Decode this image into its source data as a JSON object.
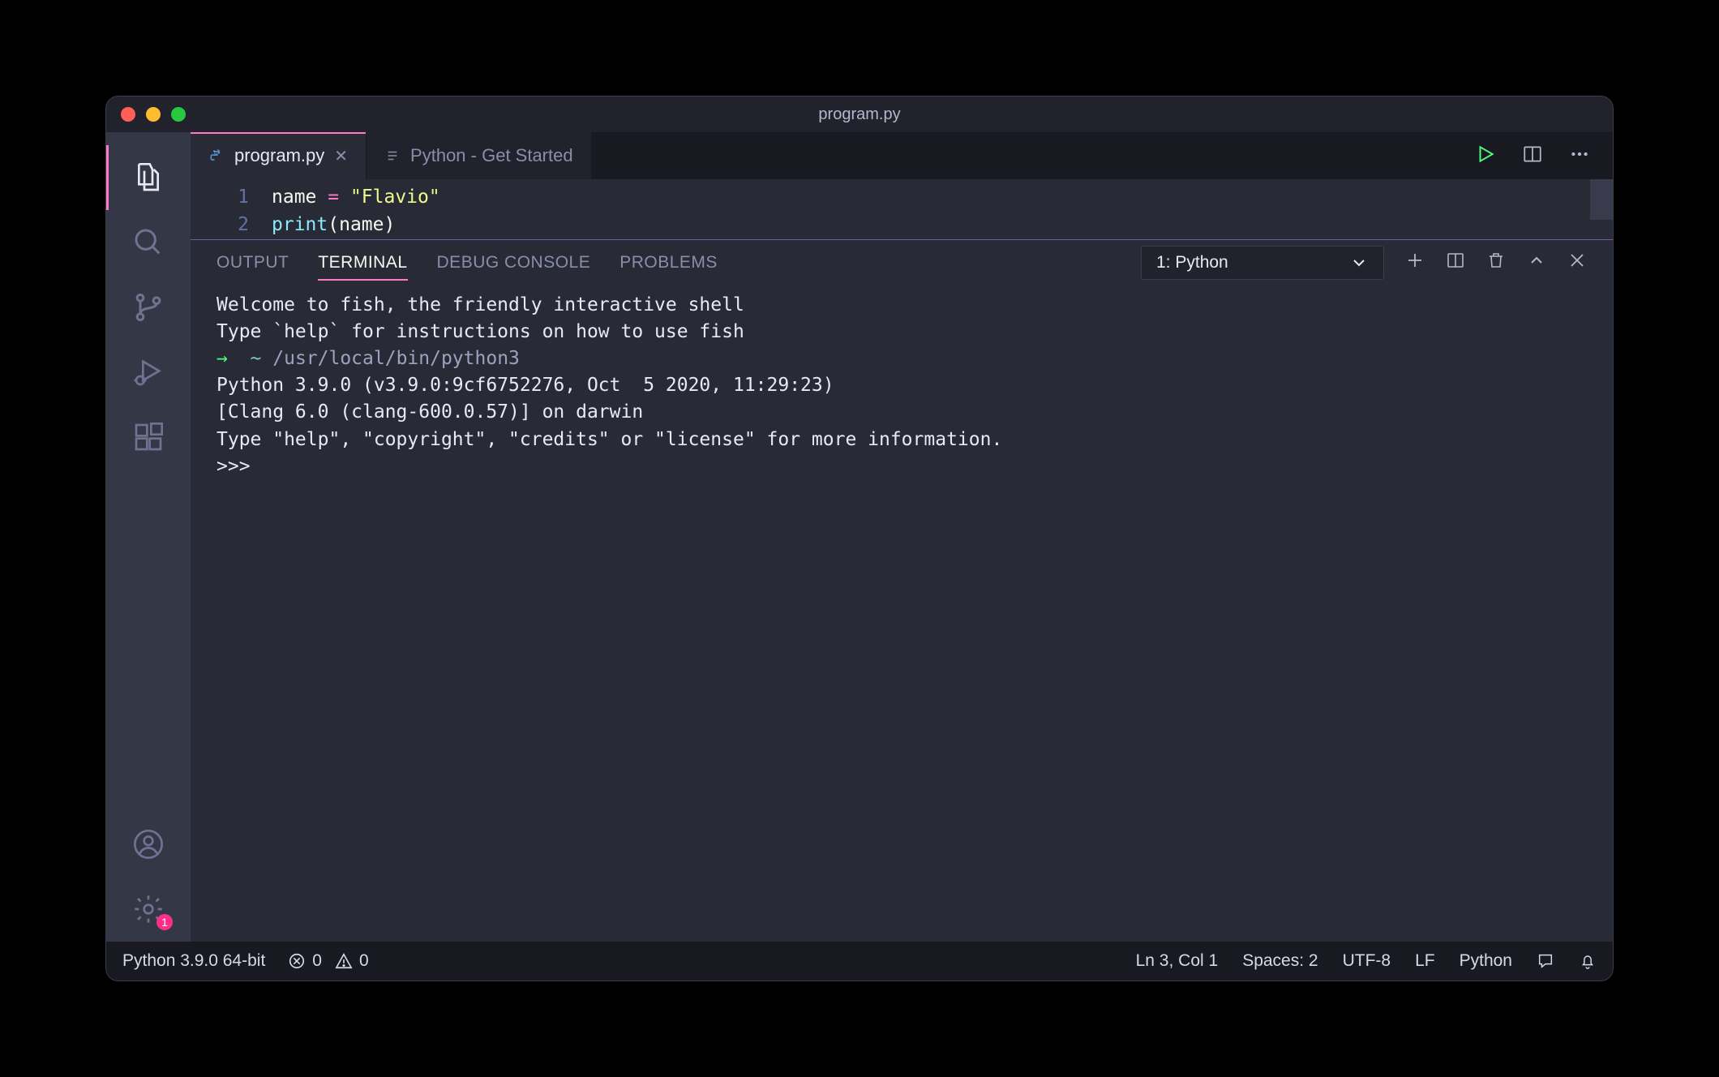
{
  "window": {
    "title": "program.py"
  },
  "activity": {
    "settings_badge": "1"
  },
  "tabs": {
    "active": {
      "label": "program.py"
    },
    "inactive": {
      "label": "Python - Get Started"
    }
  },
  "editor": {
    "gutter": [
      "1",
      "2"
    ],
    "line1": {
      "ident": "name",
      "op": " = ",
      "quote_open": "\"",
      "str": "Flavio",
      "quote_close": "\""
    },
    "line2": {
      "func": "print",
      "paren_open": "(",
      "arg": "name",
      "paren_close": ")"
    }
  },
  "panel": {
    "tabs": {
      "output": "OUTPUT",
      "terminal": "TERMINAL",
      "debug": "DEBUG CONSOLE",
      "problems": "PROBLEMS"
    },
    "select": "1: Python"
  },
  "terminal": {
    "l1": "Welcome to fish, the friendly interactive shell",
    "l2": "Type `help` for instructions on how to use fish",
    "l3_arrow": "→",
    "l3_tilde": "  ~ ",
    "l3_cmd": "/usr/local/bin/python3",
    "l4": "Python 3.9.0 (v3.9.0:9cf6752276, Oct  5 2020, 11:29:23)",
    "l5": "[Clang 6.0 (clang-600.0.57)] on darwin",
    "l6": "Type \"help\", \"copyright\", \"credits\" or \"license\" for more information.",
    "l7": ">>> "
  },
  "status": {
    "interpreter": "Python 3.9.0 64-bit",
    "errors": "0",
    "warnings": "0",
    "cursor": "Ln 3, Col 1",
    "spaces": "Spaces: 2",
    "encoding": "UTF-8",
    "eol": "LF",
    "lang": "Python"
  }
}
